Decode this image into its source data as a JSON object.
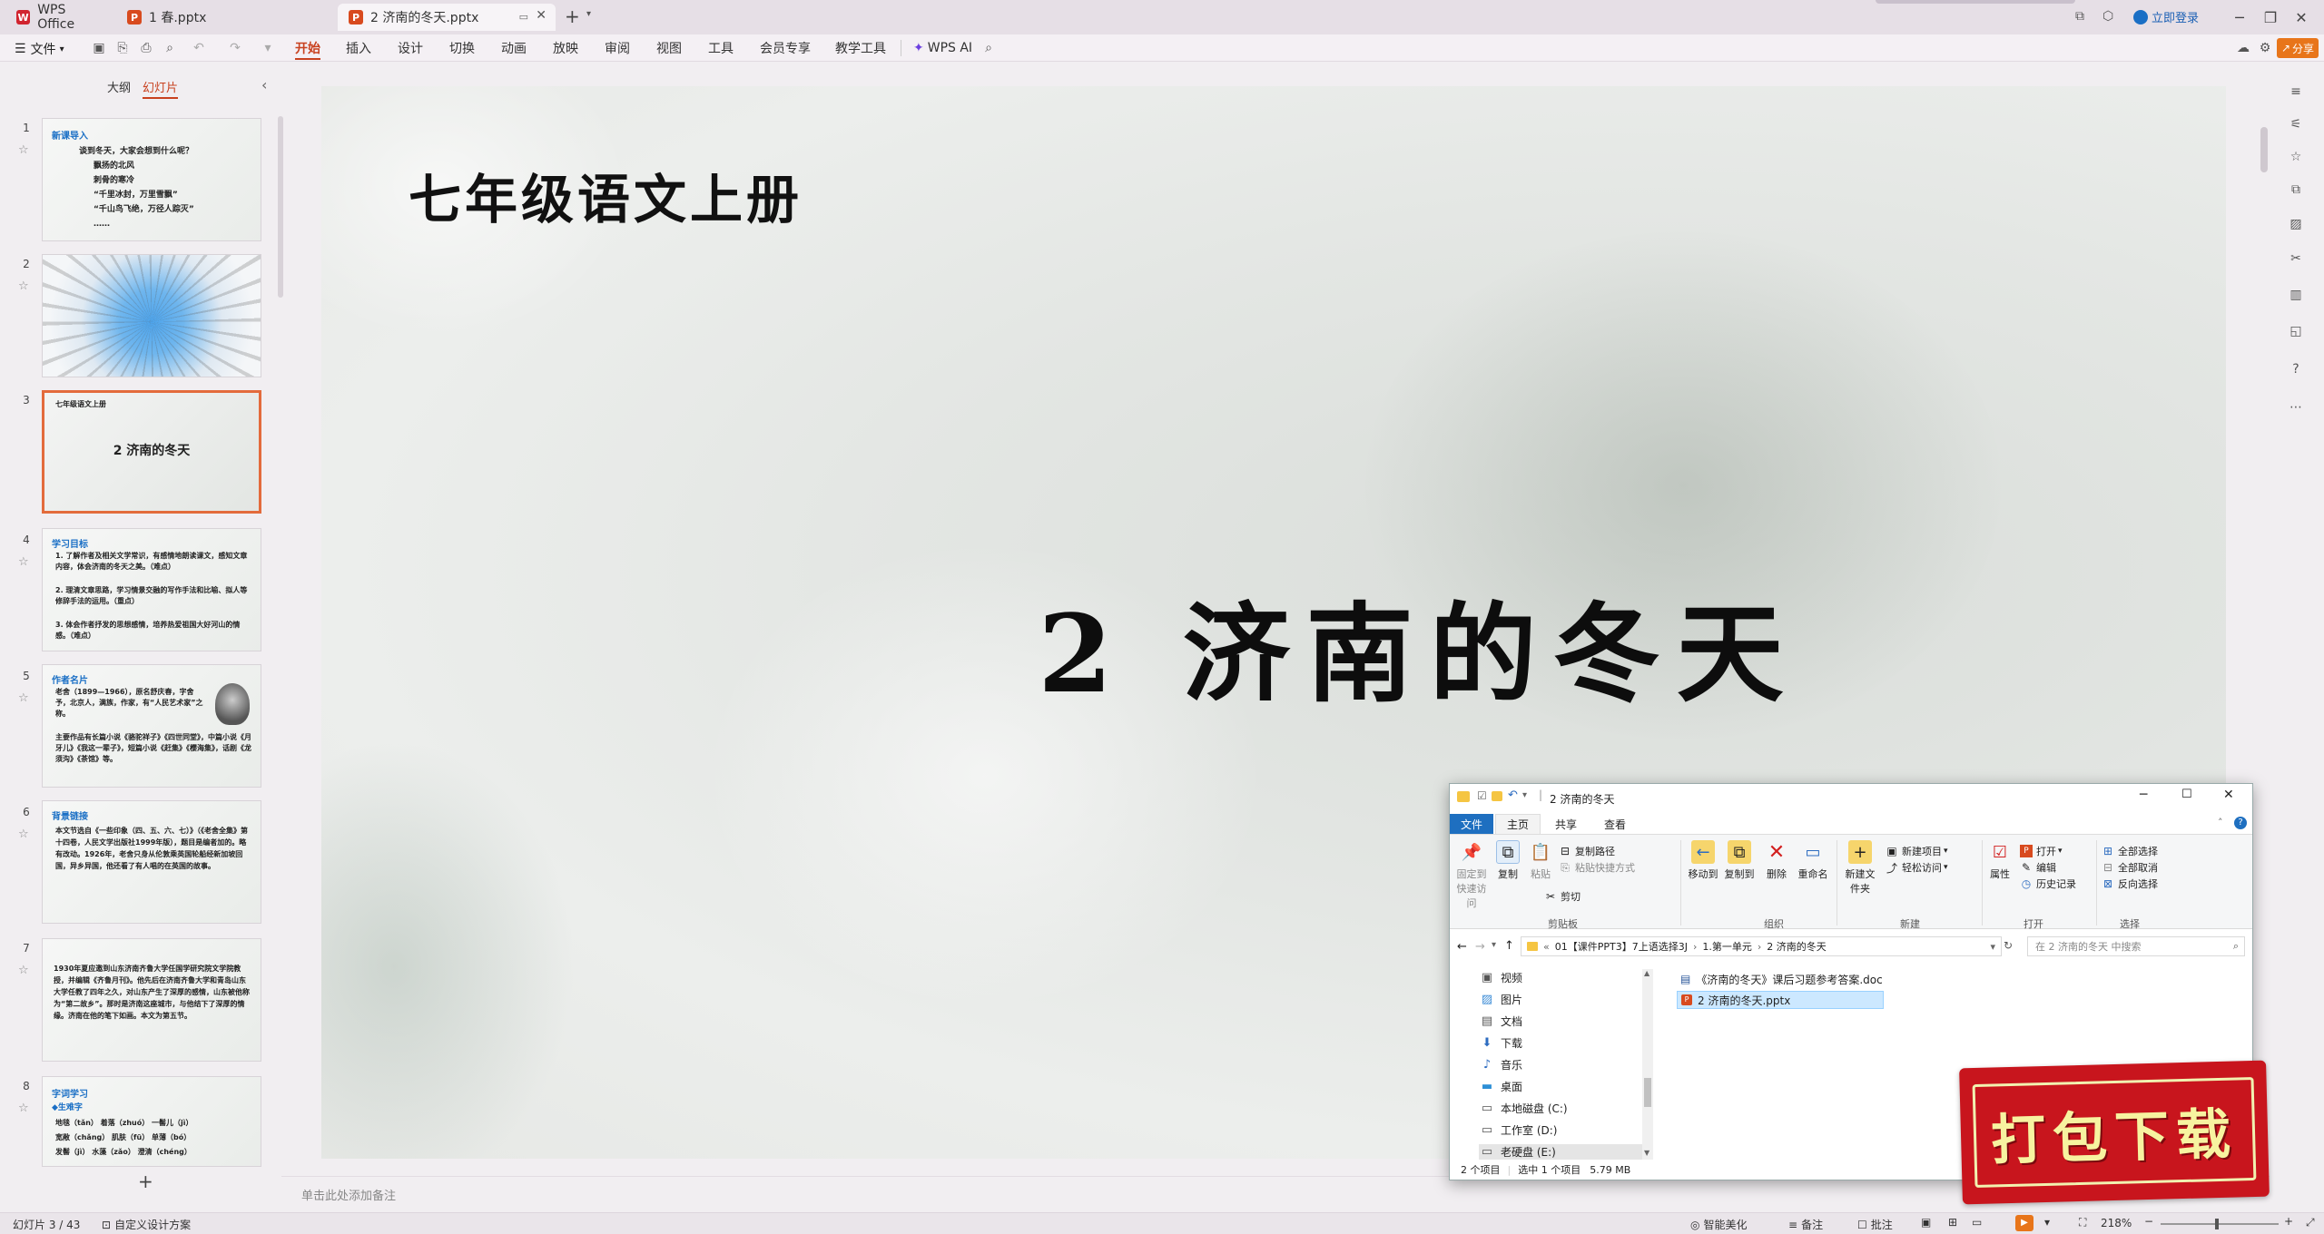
{
  "titlebar": {
    "tabs": [
      {
        "label": "WPS Office"
      },
      {
        "label": "1 春.pptx"
      },
      {
        "label": "2 济南的冬天.pptx"
      }
    ],
    "login_label": "立即登录"
  },
  "menubar": {
    "file_label": "文件",
    "items": [
      "开始",
      "插入",
      "设计",
      "切换",
      "动画",
      "放映",
      "审阅",
      "视图",
      "工具",
      "会员专享",
      "教学工具"
    ],
    "wps_ai_label": "WPS AI",
    "share_label": "分享"
  },
  "leftpanel": {
    "tab_outline": "大纲",
    "tab_slides": "幻灯片",
    "add_label": "+",
    "thumbs": [
      {
        "num": "1",
        "heading": "新课导入",
        "lines": [
          "谈到冬天，大家会想到什么呢？",
          "飘扬的北风",
          "刺骨的寒冷",
          "“千里冰封，万里雪飘”",
          "“千山鸟飞绝，万径人踪灭”",
          "……"
        ]
      },
      {
        "num": "2"
      },
      {
        "num": "3",
        "top": "七年级语文上册",
        "title": "2 济南的冬天"
      },
      {
        "num": "4",
        "heading": "学习目标",
        "lines": [
          "1. 了解作者及相关文学常识，有感情地朗读课文，感知文章内容，体会济南的冬天之美。（难点）",
          "2. 理清文章思路，学习情景交融的写作手法和比喻、拟人等修辞手法的运用。（重点）",
          "3. 体会作者抒发的思想感情，培养热爱祖国大好河山的情感。（难点）"
        ]
      },
      {
        "num": "5",
        "heading": "作者名片",
        "lines": [
          "老舍（1899—1966），原名舒庆春，字舍予，北京人，满族，作家，有“人民艺术家”之称。",
          "主要作品有长篇小说《骆驼祥子》《四世同堂》，中篇小说《月牙儿》《我这一辈子》，短篇小说《赶集》《樱海集》，话剧《龙须沟》《茶馆》等。"
        ]
      },
      {
        "num": "6",
        "heading": "背景链接",
        "lines": [
          "本文节选自《一些印象（四、五、六、七）》（《老舍全集》第十四卷，人民文学出版社1999年版），题目是编者加的。略有改动。1926年，老舍只身从伦敦乘英国轮船经新加坡回国，异乡异国，他还看了有人唱的在英国的故事。"
        ]
      },
      {
        "num": "7",
        "lines": [
          "1930年夏应邀到山东济南齐鲁大学任国学研究院文学院教授，并编辑《齐鲁月刊》。他先后在济南齐鲁大学和青岛山东大学任教了四年之久，对山东产生了深厚的感情，山东被他称为“第二故乡”。那时是济南这座城市，与他结下了深厚的情缘。济南在他的笔下如画。本文为第五节。"
        ]
      },
      {
        "num": "8",
        "heading": "字词学习",
        "sub": "◆生难字",
        "lines": [
          "地毯（tǎn） 着落（zhuó） 一髻儿（jì）",
          "宽敞（chǎng） 肌肤（fū） 单薄（bó）",
          "发髻（jì） 水藻（zǎo） 澄清（chéng）"
        ]
      }
    ]
  },
  "slide": {
    "top_title": "七年级语文上册",
    "main_title": "2 济南的冬天"
  },
  "notes": {
    "placeholder": "单击此处添加备注"
  },
  "status": {
    "slide_info": "幻灯片 3 / 43",
    "design_label": "自定义设计方案",
    "beautify_label": "智能美化",
    "notes_label": "备注",
    "comment_label": "批注",
    "zoom": "218%"
  },
  "explorer": {
    "title": "2 济南的冬天",
    "ribbon_tabs": [
      "文件",
      "主页",
      "共享",
      "查看"
    ],
    "clipboard": {
      "pin": "固定到快速访问",
      "copy": "复制",
      "paste": "粘贴",
      "copy_path": "复制路径",
      "paste_shortcut": "粘贴快捷方式",
      "cut": "剪切",
      "group": "剪贴板"
    },
    "organize": {
      "move_to": "移动到",
      "copy_to": "复制到",
      "delete": "删除",
      "rename": "重命名",
      "group": "组织"
    },
    "new": {
      "new_folder": "新建文件夹",
      "new_item": "新建项目",
      "easy_access": "轻松访问",
      "group": "新建"
    },
    "open": {
      "properties": "属性",
      "open": "打开",
      "edit": "编辑",
      "history": "历史记录",
      "group": "打开"
    },
    "select": {
      "select_all": "全部选择",
      "select_none": "全部取消",
      "invert": "反向选择",
      "group": "选择"
    },
    "path": [
      "01【课件PPT3】7上语选择3J",
      "1.第一单元",
      "2 济南的冬天"
    ],
    "search_placeholder": "在 2 济南的冬天 中搜索",
    "nav_items": [
      "视频",
      "图片",
      "文档",
      "下载",
      "音乐",
      "桌面",
      "本地磁盘 (C:)",
      "工作室 (D:)",
      "老硬盘 (E:)"
    ],
    "files": [
      {
        "name": "《济南的冬天》课后习题参考答案.doc",
        "selected": false
      },
      {
        "name": "2 济南的冬天.pptx",
        "selected": true
      }
    ],
    "status_count": "2 个项目",
    "status_selected": "选中 1 个项目",
    "status_size": "5.79 MB"
  },
  "badge": {
    "label": "打包下载"
  },
  "colors": {
    "accent": "#c8411f",
    "badge_red": "#c8151d",
    "select_blue": "#cce8ff",
    "link_blue": "#1a6fc5"
  }
}
